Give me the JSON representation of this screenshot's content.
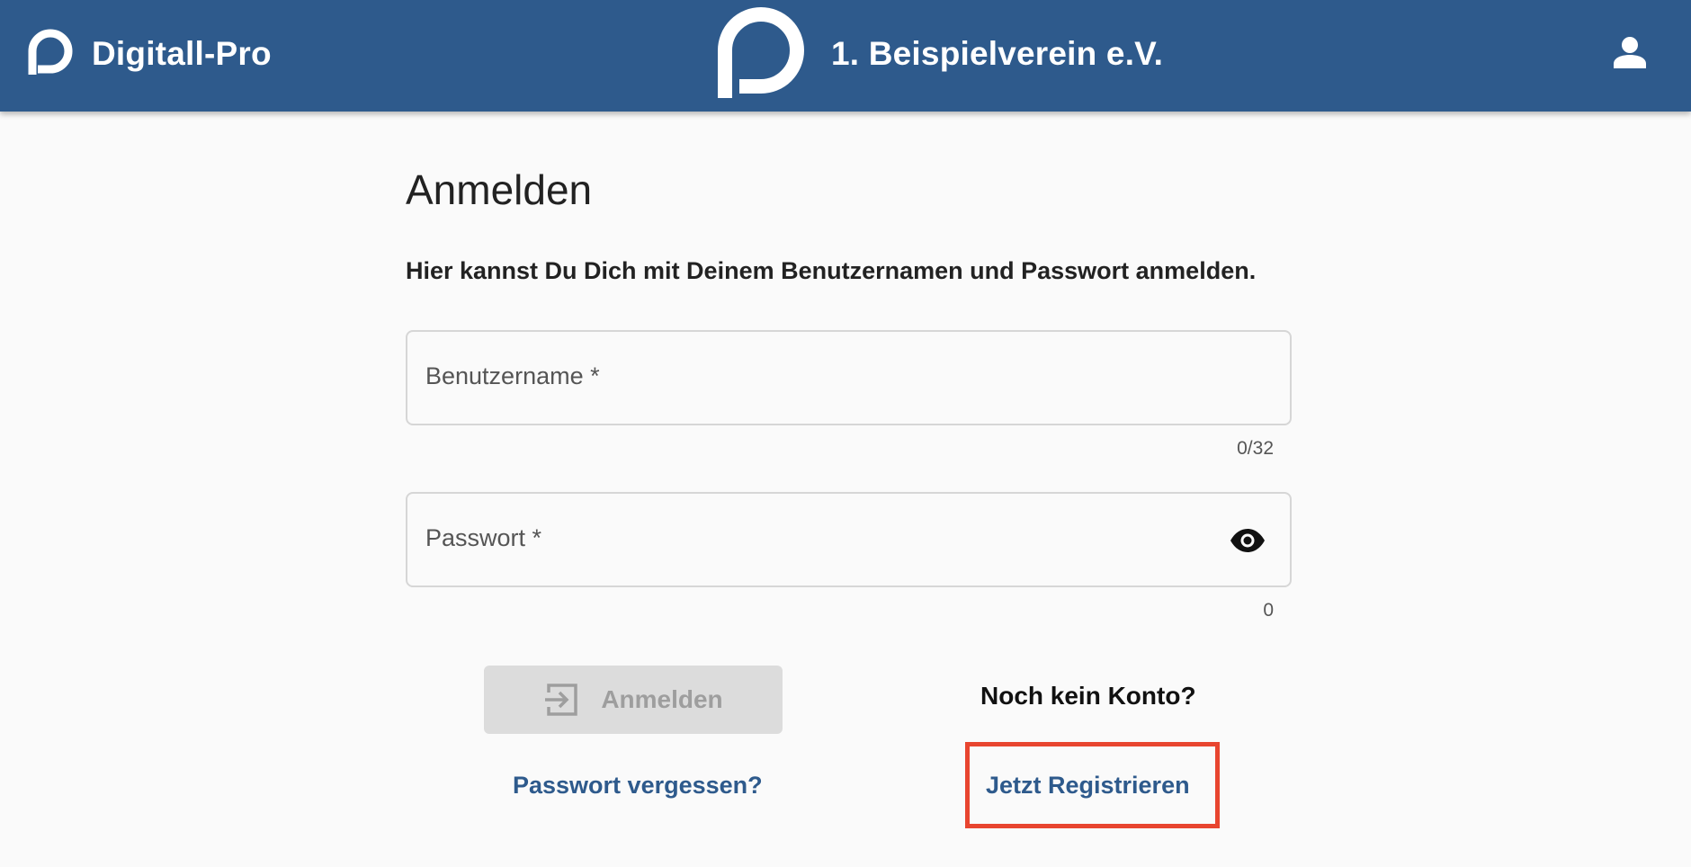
{
  "header": {
    "brand_name": "Digitall-Pro",
    "brand_icon": "digitall-logo-icon",
    "club_name": "1. Beispielverein e.V.",
    "club_icon": "club-logo-icon",
    "user_icon": "user-account-icon",
    "background_color": "#2e5a8c"
  },
  "main": {
    "title": "Anmelden",
    "intro": "Hier kannst Du Dich mit Deinem Benutzernamen und Passwort anmelden.",
    "username": {
      "label": "Benutzername *",
      "value": "",
      "counter": "0/32"
    },
    "password": {
      "label": "Passwort *",
      "value": "",
      "counter": "0",
      "visibility_icon": "eye-icon"
    },
    "login_button": {
      "label": "Anmelden",
      "icon": "login-arrow-icon",
      "disabled": true
    },
    "no_account_text": "Noch kein Konto?",
    "forgot_password_link": "Passwort vergessen?",
    "register_link": "Jetzt Registrieren"
  },
  "colors": {
    "link": "#2e5a8c",
    "highlight_border": "#e8452f",
    "disabled_button_bg": "#dcdcdc"
  }
}
